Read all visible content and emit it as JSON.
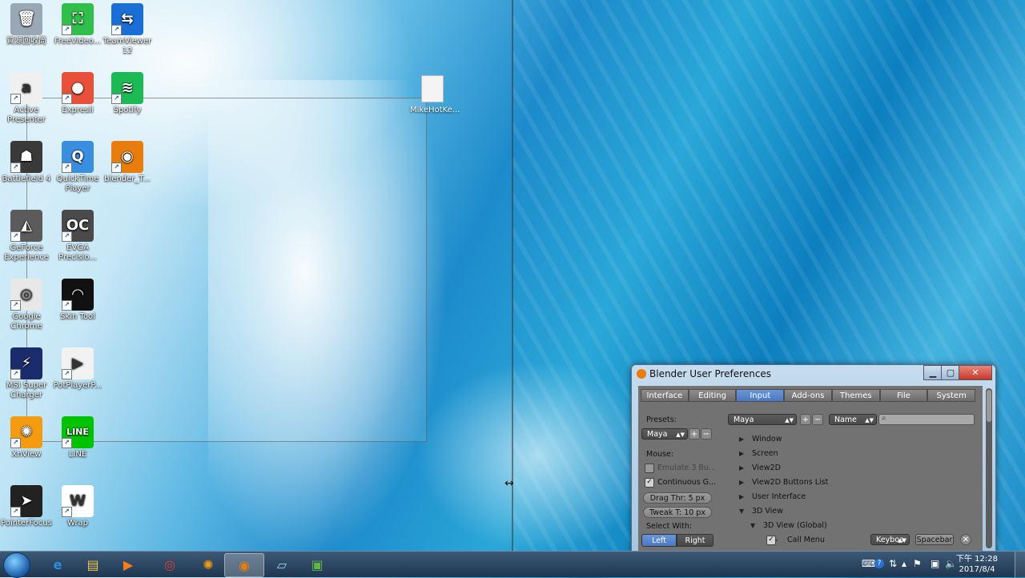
{
  "desktop": {
    "icons": [
      {
        "label": "資源回收筒",
        "color": "#9aa7b4",
        "glyph": "🗑"
      },
      {
        "label": "FreeVideo...",
        "color": "#2fbf4a",
        "glyph": "⛶"
      },
      {
        "label": "TeamViewer 12",
        "color": "#1a6fd6",
        "glyph": "⇆"
      },
      {
        "label": "Active Presenter",
        "color": "#f0f0f0",
        "glyph": "a"
      },
      {
        "label": "Expresii",
        "color": "#e8503a",
        "glyph": "●"
      },
      {
        "label": "Spotify",
        "color": "#1db954",
        "glyph": "≋"
      },
      {
        "label": "Battlefield 4",
        "color": "#3a3a3a",
        "glyph": "☗"
      },
      {
        "label": "QuickTime Player",
        "color": "#3a8ee0",
        "glyph": "Q"
      },
      {
        "label": "blender_T...",
        "color": "#e87d0d",
        "glyph": "◉"
      },
      {
        "label": "GeForce Experience",
        "color": "#5b5b5b",
        "glyph": "◭"
      },
      {
        "label": "EVGA Precisio...",
        "color": "#4a4a4a",
        "glyph": "OC"
      },
      {
        "label": "Google Chrome",
        "color": "#e8e8e8",
        "glyph": "◎"
      },
      {
        "label": "Skin Tool",
        "color": "#111111",
        "glyph": "◠"
      },
      {
        "label": "MSI Super Charger",
        "color": "#1b2c6c",
        "glyph": "⚡"
      },
      {
        "label": "PotPlayerP...",
        "color": "#f2f2f2",
        "glyph": "▶"
      },
      {
        "label": "XnView",
        "color": "#f39c12",
        "glyph": "✺"
      },
      {
        "label": "LINE",
        "color": "#00c300",
        "glyph": "LINE"
      },
      {
        "label": "PointerFocus",
        "color": "#222222",
        "glyph": "➤"
      },
      {
        "label": "Wrap",
        "color": "#ffffff",
        "glyph": "W"
      }
    ],
    "file": {
      "label": "MikeHotKe..."
    }
  },
  "taskbar": {
    "apps": [
      {
        "name": "internet-explorer",
        "glyph": "e",
        "color": "#2a8fe0"
      },
      {
        "name": "file-explorer",
        "glyph": "▤",
        "color": "#f1c24b"
      },
      {
        "name": "media-player",
        "glyph": "▶",
        "color": "#f07f1a"
      },
      {
        "name": "chrome",
        "glyph": "◎",
        "color": "#e34133"
      },
      {
        "name": "xnview",
        "glyph": "✺",
        "color": "#f39c12"
      },
      {
        "name": "blender",
        "glyph": "◉",
        "color": "#e87d0d"
      },
      {
        "name": "notepad",
        "glyph": "▱",
        "color": "#9fd0ea"
      },
      {
        "name": "photo-app",
        "glyph": "▣",
        "color": "#5fb548"
      }
    ],
    "clock": {
      "time": "下午 12:28",
      "date": "2017/8/4"
    }
  },
  "prefs": {
    "title": "Blender User Preferences",
    "tabs": [
      "Interface",
      "Editing",
      "Input",
      "Add-ons",
      "Themes",
      "File",
      "System"
    ],
    "active_tab": "Input",
    "presets_label": "Presets:",
    "preset_value": "Maya",
    "preset_value_small": "Maya",
    "sort_value": "Name",
    "mouse_label": "Mouse:",
    "emulate": "Emulate 3 Bu...",
    "continuous": "Continuous G...",
    "drag": "Drag Thr:  5 px",
    "tweak": "Tweak T: 10 px",
    "select_with": "Select With:",
    "left": "Left",
    "right": "Right",
    "tree": [
      "Window",
      "Screen",
      "View2D",
      "View2D Buttons List",
      "User Interface",
      "3D View",
      "3D View (Global)",
      "Call Menu"
    ],
    "keyboard": "Keyboa",
    "key": "Spacebar"
  }
}
